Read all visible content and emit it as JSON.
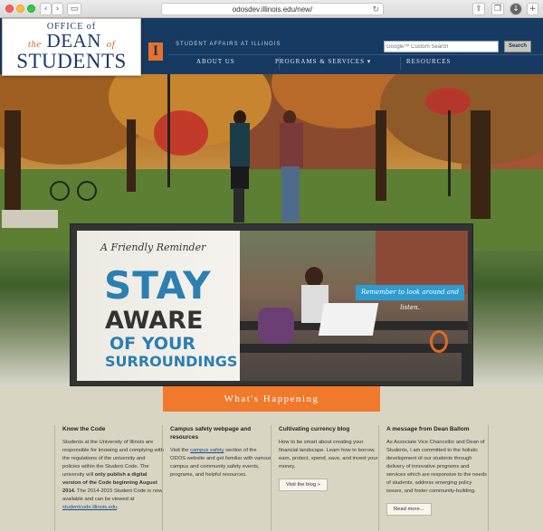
{
  "browser": {
    "url": "odosdev.illinois.edu/new/",
    "reload_icon": "↻"
  },
  "logo": {
    "line1": "OFFICE of",
    "the": "the",
    "dean": "DEAN",
    "of": "of",
    "line3": "STUDENTS"
  },
  "header": {
    "i_mark": "I",
    "tagline": "STUDENT AFFAIRS AT ILLINOIS",
    "search_placeholder": "Google™ Custom Search",
    "search_button": "Search"
  },
  "nav": {
    "items": [
      "ABOUT US",
      "PROGRAMS & SERVICES ▾",
      "RESOURCES"
    ]
  },
  "hero": {
    "reminder_label": "A Friendly Reminder",
    "stay": "STAY",
    "aware": "AWARE",
    "of_your": "OF YOUR",
    "surroundings": "SURROUNDINGS",
    "remember_text": "Remember to look around and listen."
  },
  "whats_happening": {
    "label": "What's Happening",
    "columns": [
      {
        "title": "Know the Code",
        "body_parts": [
          "Students at the University of Illinois are responsible for knowing and complying with the regulations of the university and policies within the Student Code. The university will ",
          "only publish a digital version of the Code beginning August 2014.",
          " The 2014-2015 Student Code is now available and can be viewed at ",
          "studentcode.illinois.edu",
          "."
        ]
      },
      {
        "title": "Campus safety webpage and resources",
        "body_parts": [
          "Visit the ",
          "campus safety",
          " section of the ODOS website and get familiar with various campus and community safety events, programs, and helpful resources."
        ]
      },
      {
        "title": "Cultivating currency blog",
        "body": "How to be smart about creating your financial landscape. Learn how to borrow, earn, protect, spend, save, and invest your money.",
        "button": "Visit the blog »"
      },
      {
        "title": "A message from Dean Ballom",
        "body": "As Associate Vice Chancellor and Dean of Students, I am committed to the holistic development of our students through delivery of innovative programs and services which are responsive to the needs of students, address emerging policy issues, and foster community-building.",
        "button": "Read more..."
      }
    ]
  },
  "colors": {
    "navy": "#173a62",
    "orange": "#f0792c",
    "blue_text": "#2b7fb1",
    "tan": "#d9d5c3"
  }
}
